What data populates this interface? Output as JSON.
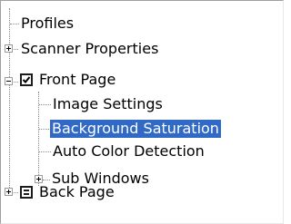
{
  "tree": {
    "items": [
      {
        "label": "Profiles"
      },
      {
        "label": "Scanner Properties",
        "expander": "collapsed"
      },
      {
        "label": "Front Page",
        "expander": "expanded",
        "checkbox": "checked"
      },
      {
        "label": "Image Settings"
      },
      {
        "label": "Background Saturation",
        "selected": true
      },
      {
        "label": "Auto Color Detection"
      },
      {
        "label": "Sub Windows",
        "expander": "collapsed"
      },
      {
        "label": "Back Page",
        "expander": "collapsed",
        "icon": "page-icon"
      }
    ]
  },
  "colors": {
    "selection": "#3169c6",
    "tree_lines": "#8a8a8a"
  }
}
